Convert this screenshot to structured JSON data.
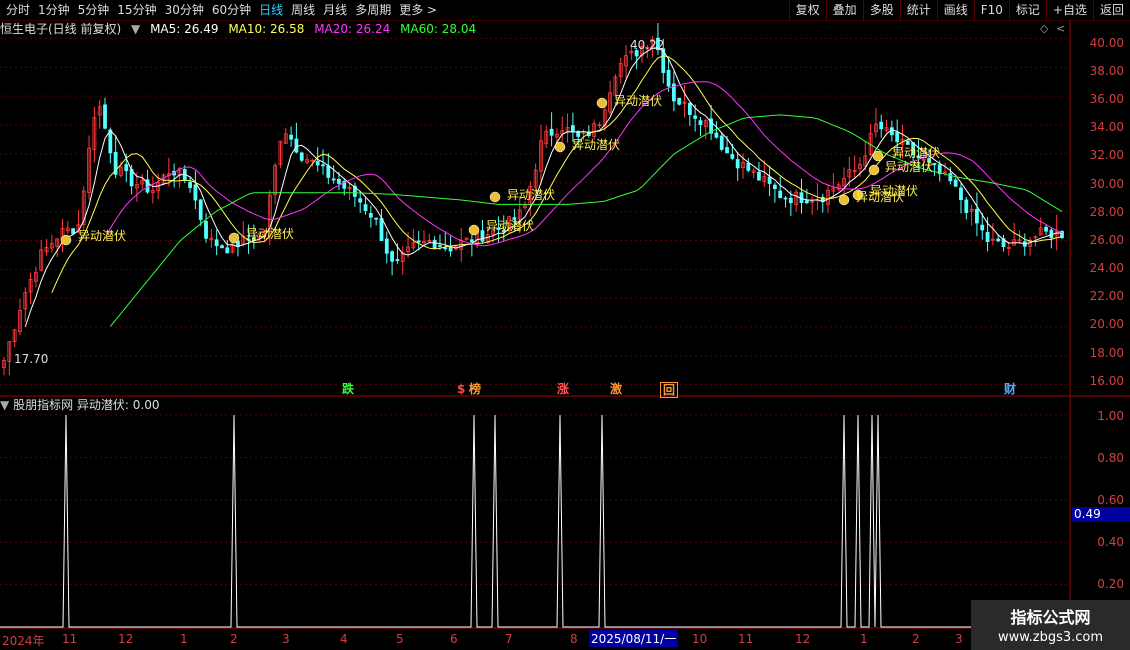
{
  "toolbar": {
    "tabs": [
      "分时",
      "1分钟",
      "5分钟",
      "15分钟",
      "30分钟",
      "60分钟",
      "日线",
      "周线",
      "月线",
      "多周期",
      "更多 >"
    ],
    "active_tab": "日线",
    "right_buttons": [
      "复权",
      "叠加",
      "多股",
      "统计",
      "画线",
      "F10",
      "标记",
      "+自选",
      "返回"
    ]
  },
  "main_chart": {
    "title": "恒生电子(日线 前复权)",
    "ma": [
      {
        "label": "MA5: 26.49",
        "color": "#ffffff"
      },
      {
        "label": "MA10: 26.58",
        "color": "#ffff55"
      },
      {
        "label": "MA20: 26.24",
        "color": "#ff33ff"
      },
      {
        "label": "MA60: 28.04",
        "color": "#33ff33"
      }
    ],
    "price_axis": [
      "40.00",
      "38.00",
      "36.00",
      "34.00",
      "32.00",
      "30.00",
      "28.00",
      "26.00",
      "24.00",
      "22.00",
      "20.00",
      "18.00",
      "16.00"
    ],
    "high_label": "40.22",
    "low_label": "17.70",
    "signal_label": "异动潜伏",
    "event_badges": [
      {
        "text": "跌",
        "color": "#33ff33"
      },
      {
        "text": "$",
        "color": "#ff4444"
      },
      {
        "text": "榜",
        "color": "#ff9933"
      },
      {
        "text": "涨",
        "color": "#ff5555"
      },
      {
        "text": "激",
        "color": "#ff9933"
      },
      {
        "text": "回",
        "color": "#ff9933"
      },
      {
        "text": "财",
        "color": "#55aaff"
      }
    ]
  },
  "sub_chart": {
    "title": "股朋指标网",
    "indicator": "异动潜伏: 0.00",
    "axis": [
      "1.00",
      "0.80",
      "0.60",
      "0.40",
      "0.20"
    ],
    "cursor_value": "0.49"
  },
  "x_axis": [
    "2024年",
    "11",
    "12",
    "1",
    "2",
    "3",
    "4",
    "5",
    "6",
    "7",
    "8",
    "2025/08/11/一",
    "10",
    "11",
    "12",
    "1",
    "2",
    "3"
  ],
  "watermark": {
    "line1": "指标公式网",
    "line2": "www.zbgs3.com"
  },
  "chart_data": {
    "type": "candlestick",
    "title": "恒生电子(日线 前复权)",
    "ylim": [
      15.5,
      41
    ],
    "approx_close_path": [
      17.7,
      22,
      25,
      26.5,
      27,
      36,
      31,
      30,
      29.5,
      31,
      30,
      26,
      25.5,
      26,
      26.5,
      34,
      32,
      31,
      30,
      29,
      27.5,
      24,
      25.5,
      26,
      25.5,
      26,
      26.5,
      27,
      28,
      33,
      34,
      33,
      34,
      38,
      39,
      40.2,
      36,
      35,
      34,
      32,
      31,
      30,
      29,
      29,
      29,
      30,
      31,
      34,
      33,
      32,
      31,
      30,
      28,
      26,
      25.5,
      26,
      26.5,
      26.5
    ],
    "ma60_path": [
      null,
      null,
      null,
      20,
      23,
      26,
      28,
      29.3,
      29.3,
      29.3,
      29.3,
      29.2,
      29,
      28.8,
      28.5,
      28.5,
      28.5,
      28.7,
      29.5,
      32,
      33.5,
      34.5,
      34.7,
      34.5,
      33.5,
      32,
      31,
      30.4,
      30,
      29.5,
      28
    ]
  }
}
